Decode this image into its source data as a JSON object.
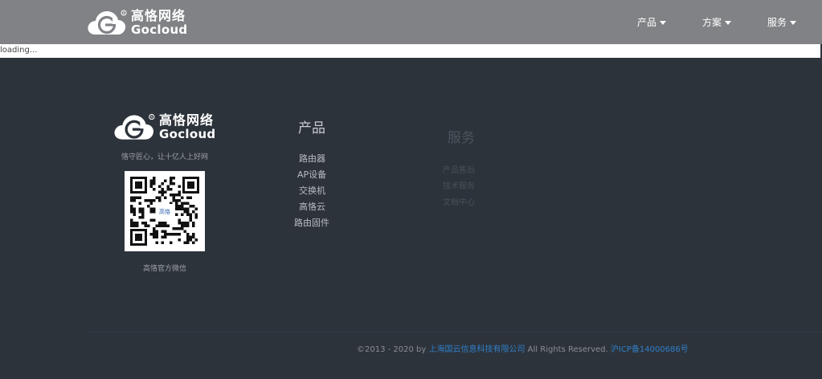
{
  "header": {
    "logo": {
      "cn": "高恪网络",
      "en": "Gocloud"
    },
    "nav": [
      {
        "label": "产品"
      },
      {
        "label": "方案"
      },
      {
        "label": "服务"
      }
    ]
  },
  "loading_text": "loading...",
  "footer": {
    "logo": {
      "cn": "高恪网络",
      "en": "Gocloud"
    },
    "slogan": "恪守匠心，让十亿人上好网",
    "qr_center_label": "高恪",
    "qr_caption": "高恪官方微信",
    "products": {
      "title": "产品",
      "items": [
        "路由器",
        "AP设备",
        "交换机",
        "高恪云",
        "路由固件"
      ]
    },
    "services": {
      "title": "服务",
      "items": [
        "产品售后",
        "技术服务",
        "文档中心"
      ]
    },
    "copyright": {
      "prefix": "©2013 - 2020 by ",
      "company": "上海国云信息科技有限公司",
      "middle": " All Rights Reserved. ",
      "icp": "沪ICP备14000686号"
    }
  },
  "colors": {
    "header_bg": "#808285",
    "page_bg": "#2d333b",
    "link_blue": "#2f7fc9"
  }
}
